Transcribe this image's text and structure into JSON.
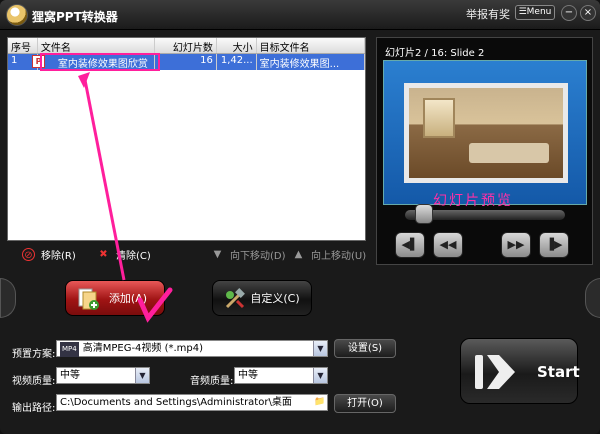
{
  "window": {
    "title": "狸窝PPT转换器",
    "report_label": "举报有奖",
    "menu_label": "Menu",
    "menu_glyph": "☰",
    "minimize_glyph": "−",
    "close_glyph": "×"
  },
  "file_list": {
    "columns": [
      "序号",
      "文件名",
      "幻灯片数",
      "大小",
      "目标文件名"
    ],
    "rows": [
      {
        "index": "1",
        "filename": "室内装修效果图欣赏",
        "slides": "16",
        "size": "1,42...",
        "target": "室内装修效果图..."
      }
    ],
    "file_icon_glyph": "P"
  },
  "list_toolbar": {
    "remove": "移除(R)",
    "remove_glyph": "⊘",
    "clear": "清除(C)",
    "clear_glyph": "✖",
    "move_down": "向下移动(D)",
    "move_down_glyph": "▼",
    "move_up": "向上移动(U)",
    "move_up_glyph": "▲"
  },
  "actions": {
    "add": "添加(A)",
    "customize": "自定义(C)"
  },
  "preview": {
    "slide_info": "幻灯片2 / 16: Slide 2",
    "overlay_label": "幻灯片预览",
    "progress": 0.12,
    "controls": [
      "◀▌",
      "◀◀",
      "▶▶",
      "▐▶"
    ]
  },
  "settings": {
    "preset_label": "预置方案:",
    "preset_icon_text": "MP4",
    "preset_value": "高清MPEG-4视频 (*.mp4)",
    "settings_button": "设置(S)",
    "video_quality_label": "视频质量:",
    "video_quality_value": "中等",
    "audio_quality_label": "音频质量:",
    "audio_quality_value": "中等",
    "output_label": "输出路径:",
    "output_path": "C:\\Documents and Settings\\Administrator\\桌面",
    "open_button": "打开(O)",
    "dropdown_glyph": "▼",
    "folder_glyph": "📁"
  },
  "start": {
    "label": "Start"
  },
  "colors": {
    "selection": "#3d6fd8",
    "annotation": "#ff1f9c",
    "add_button": "#c92424"
  }
}
